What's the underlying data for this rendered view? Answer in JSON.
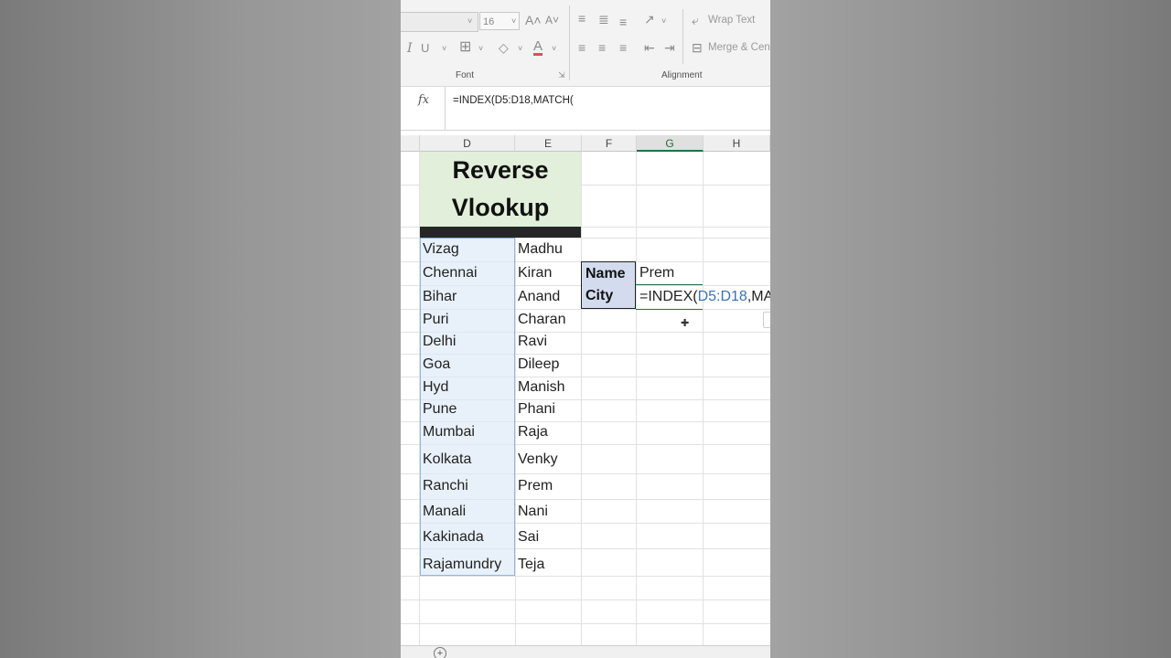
{
  "ribbon": {
    "font_size": "16",
    "font_group_label": "Font",
    "alignment_group_label": "Alignment",
    "wrap_text_label": "Wrap Text",
    "merge_label": "Merge & Cent",
    "italic_label": "I",
    "grow_font_icon": "A˄",
    "shrink_font_icon": "A˅",
    "font_color_icon": "A",
    "align_top_icon": "≡",
    "align_middle_icon": "≣",
    "align_bottom_icon": "≡",
    "orientation_icon": "↗",
    "align_left_icon": "≡",
    "align_center_icon": "≡",
    "align_right_icon": "≡",
    "decrease_indent_icon": "⇤",
    "increase_indent_icon": "⇥",
    "borders_icon": "⊞",
    "fill_color_icon": "◇",
    "dropdown_icon": "˅",
    "launcher_icon": "⇲"
  },
  "formula_bar": {
    "fx": "fx",
    "formula": "=INDEX(D5:D18,MATCH("
  },
  "columns": [
    "D",
    "E",
    "F",
    "G",
    "H"
  ],
  "title": {
    "line1": "Reverse",
    "line2": "Vlookup"
  },
  "table": {
    "cities": [
      "Vizag",
      "Chennai",
      "Bihar",
      "Puri",
      "Delhi",
      "Goa",
      "Hyd",
      "Pune",
      "Mumbai",
      "Kolkata",
      "Ranchi",
      "Manali",
      "Kakinada",
      "Rajamundry"
    ],
    "names": [
      "Madhu",
      "Kiran",
      "Anand",
      "Charan",
      "Ravi",
      "Dileep",
      "Manish",
      "Phani",
      "Raja",
      "Venky",
      "Prem",
      "Nani",
      "Sai",
      "Teja"
    ]
  },
  "lookup": {
    "name_label": "Name",
    "name_value": "Prem",
    "city_label": "City",
    "edit_prefix": "=INDEX(",
    "edit_ref": "D5:D18",
    "edit_suffix": ",MATCH("
  },
  "sheet": {
    "add_sheet_icon": "+"
  },
  "icons": {
    "cursor": "✚"
  }
}
